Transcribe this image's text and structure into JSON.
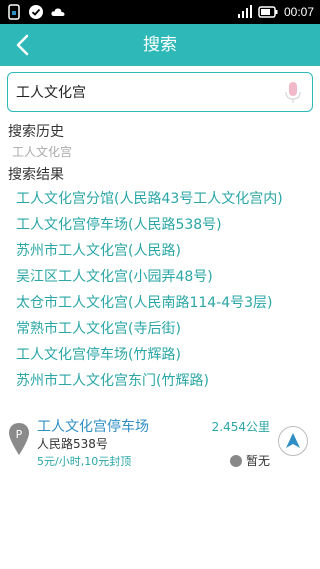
{
  "status_bar": {
    "time": "00:07",
    "icons": [
      "sim-lock-icon",
      "notification-check-icon",
      "cloud-icon",
      "signal-icon",
      "battery-icon"
    ]
  },
  "header": {
    "title": "搜索",
    "back_icon": "chevron-left-icon"
  },
  "search": {
    "value": "工人文化宫",
    "mic_icon": "microphone-icon"
  },
  "history": {
    "label": "搜索历史",
    "items": [
      "工人文化宫"
    ]
  },
  "results": {
    "label": "搜索结果",
    "items": [
      "工人文化宫分馆(人民路43号工人文化宫内)",
      "工人文化宫停车场(人民路538号)",
      "苏州市工人文化宫(人民路)",
      "吴江区工人文化宫(小园弄48号)",
      "太仓市工人文化宫(人民南路114-4号3层)",
      "常熟市工人文化宫(寺后街)",
      "工人文化宫停车场(竹辉路)",
      "苏州市工人文化宫东门(竹辉路)"
    ]
  },
  "detail": {
    "name": "工人文化宫停车场",
    "distance": "2.454公里",
    "address": "人民路538号",
    "price": "5元/小时,10元封顶",
    "status": "暂无",
    "pin_icon": "parking-pin-icon",
    "nav_icon": "navigation-arrow-icon"
  },
  "colors": {
    "accent": "#2fb8b8",
    "link": "#2aa6a6",
    "title_link": "#2f8fc4",
    "status_bar": "#000000"
  }
}
